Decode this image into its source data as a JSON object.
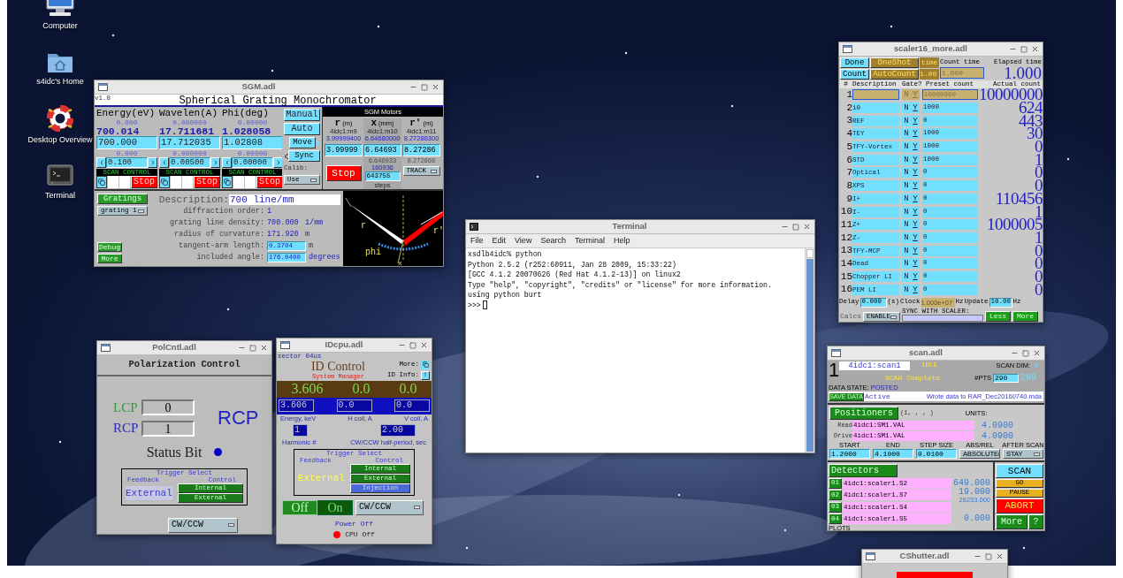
{
  "desktop_icons": [
    {
      "kind": "computer",
      "label": "Computer"
    },
    {
      "kind": "folder",
      "label": "s4idc's Home"
    },
    {
      "kind": "lifebuoy",
      "label": "Desktop Overview"
    },
    {
      "kind": "terminal",
      "label": "Terminal"
    }
  ],
  "sgm": {
    "title": "SGM.adl",
    "version": "v1.8",
    "heading": "Spherical Grating Monochromator",
    "axes": [
      {
        "header": "Energy(eV)",
        "low": "0.000",
        "readback": "700.014",
        "setpoint": "700.000",
        "high": "0.000",
        "step": "0.100",
        "scan_control": "SCAN CONTROL",
        "stop": "Stop"
      },
      {
        "header": "Wavelen(A)",
        "low": "0.000000",
        "readback": "17.711681",
        "setpoint": "17.712035",
        "high": "0.000000",
        "step": "0.00500",
        "scan_control": "SCAN CONTROL",
        "stop": "Stop"
      },
      {
        "header": "Phi(deg)",
        "low": "0.00000",
        "readback": "1.028058",
        "setpoint": "1.02808",
        "high": "0.00000",
        "step": "0.00000",
        "scan_control": "SCAN CONTROL",
        "stop": "Stop"
      }
    ],
    "modes": [
      "Manual",
      "Auto"
    ],
    "move": "Move",
    "sync": "Sync",
    "calib_label": "Calib:",
    "calib_menu": "Use",
    "motors_title": "SGM Motors",
    "motors": [
      {
        "symbol": "r",
        "unit": "(m)",
        "pv": "4idc1:m9",
        "readback": "3.99999400",
        "setpoint": "3.99999"
      },
      {
        "symbol": "x",
        "unit": "(mm)",
        "pv": "4idc1:m10",
        "readback": "6.64680000",
        "setpoint": "6.64693",
        "actual": "6.646933",
        "steps_readback": "160936",
        "steps_setpoint": "643755",
        "steps_label": "steps"
      },
      {
        "symbol": "r'",
        "unit": "(m)",
        "pv": "4idc1:m11",
        "readback": "8.27286300",
        "setpoint": "8.27286",
        "actual": "8.272868",
        "menu": "TRACK"
      }
    ],
    "motor_stop": "Stop",
    "gratings_button": "Gratings",
    "grating_menu": "grating 1",
    "description_label": "Description:",
    "description": "700 line/mm",
    "params": [
      {
        "kind": "text",
        "label": "diffraction order:",
        "value": "1"
      },
      {
        "kind": "text",
        "label": "grating line density:",
        "value": "700.000",
        "unit": "1/mm"
      },
      {
        "kind": "text",
        "label": "radius of curvature:",
        "value": "171.920",
        "unit": "m"
      },
      {
        "kind": "field",
        "label": "tangent-arm length:",
        "value": "0.3704",
        "unit": "m"
      },
      {
        "kind": "field",
        "label": "included angle:",
        "value": "176.0400",
        "unit": "degrees"
      }
    ],
    "debug_button": "Debug",
    "more_button": "More",
    "diagram_labels": [
      "r",
      "r'",
      "phi",
      "x"
    ]
  },
  "scaler": {
    "title": "scaler16_more.adl",
    "done": "Done",
    "count": "Count",
    "oneshot": "OneShot",
    "autocount": "AutoCount",
    "time_label": "time",
    "time_value": "1.00",
    "count_time_label": "Count time",
    "count_time": "1.000",
    "elapsed_label": "Elapsed time",
    "elapsed": "1.000",
    "columns": [
      "#",
      "Description",
      "Gate?",
      "Preset count",
      "Actual count"
    ],
    "rows": [
      {
        "num": "1",
        "gate_n": "N",
        "gate_y": "Y",
        "preset": "10000000",
        "actual": "10000000",
        "active": true
      },
      {
        "num": "2",
        "description": "i0",
        "gate_n": "N",
        "gate_y": "Y",
        "preset": "1000",
        "actual": "624",
        "active": false
      },
      {
        "num": "3",
        "description": "REF",
        "gate_n": "N",
        "gate_y": "Y",
        "preset": "0",
        "actual": "443",
        "active": false
      },
      {
        "num": "4",
        "description": "TEY",
        "gate_n": "N",
        "gate_y": "Y",
        "preset": "1000",
        "actual": "30",
        "active": false
      },
      {
        "num": "5",
        "description": "TFY-Vortex",
        "gate_n": "N",
        "gate_y": "Y",
        "preset": "1000",
        "actual": "0",
        "active": false
      },
      {
        "num": "6",
        "description": "STD",
        "gate_n": "N",
        "gate_y": "Y",
        "preset": "1000",
        "actual": "1",
        "active": false
      },
      {
        "num": "7",
        "description": "Optical",
        "gate_n": "N",
        "gate_y": "Y",
        "preset": "0",
        "actual": "0",
        "active": false
      },
      {
        "num": "8",
        "description": "XPS",
        "gate_n": "N",
        "gate_y": "Y",
        "preset": "0",
        "actual": "0",
        "active": false
      },
      {
        "num": "9",
        "description": "I+",
        "gate_n": "N",
        "gate_y": "Y",
        "preset": "0",
        "actual": "110456",
        "active": false
      },
      {
        "num": "10",
        "description": "I-",
        "gate_n": "N",
        "gate_y": "Y",
        "preset": "0",
        "actual": "1",
        "active": false
      },
      {
        "num": "11",
        "description": "Z+",
        "gate_n": "N",
        "gate_y": "Y",
        "preset": "0",
        "actual": "1000005",
        "active": false
      },
      {
        "num": "12",
        "description": "Z-",
        "gate_n": "N",
        "gate_y": "Y",
        "preset": "0",
        "actual": "1",
        "active": false
      },
      {
        "num": "13",
        "description": "TFY-MCP",
        "gate_n": "N",
        "gate_y": "Y",
        "preset": "0",
        "actual": "0",
        "active": false
      },
      {
        "num": "14",
        "description": "Dead",
        "gate_n": "N",
        "gate_y": "Y",
        "preset": "0",
        "actual": "0",
        "active": false
      },
      {
        "num": "15",
        "description": "Chopper LI",
        "gate_n": "N",
        "gate_y": "Y",
        "preset": "0",
        "actual": "0",
        "active": false
      },
      {
        "num": "16",
        "description": "PEM LI",
        "gate_n": "N",
        "gate_y": "Y",
        "preset": "0",
        "actual": "0",
        "active": false
      }
    ],
    "delay_label": "Delay",
    "delay": "0.000",
    "delay_unit": "(s)",
    "clock_label": "Clock",
    "clock": "1.000e+07",
    "clock_unit": "Hz",
    "update_label": "Update",
    "update": "10.00",
    "update_unit": "Hz",
    "calcs_label": "Calcs",
    "calcs_menu": "ENABLE",
    "sync_label": "SYNC WITH SCALER:",
    "less": "Less",
    "more": "More"
  },
  "terminal": {
    "title": "Terminal",
    "menu": [
      "File",
      "Edit",
      "View",
      "Search",
      "Terminal",
      "Help"
    ],
    "lines": [
      "xsdlb4idc% python",
      "Python 2.5.2 (r252:60911, Jan 28 2009, 15:33:22)",
      "[GCC 4.1.2 20070626 (Red Hat 4.1.2-13)] on linux2",
      "Type \"help\", \"copyright\", \"credits\" or \"license\" for more information.",
      "using python burt"
    ],
    "prompt": ">>>"
  },
  "scan": {
    "title": "scan.adl",
    "index": "1",
    "record": "4idc1:scan1",
    "status": "IDLE",
    "dim_label": "SCAN DIM:",
    "dim": "0",
    "message": "SCAN Complete",
    "pts_label": "#PTS",
    "pts_set": "290",
    "pts": "290",
    "data_state_label": "DATA STATE:",
    "data_state": "POSTED",
    "save_button": "SAVE DATA",
    "save_state": "Active",
    "save_message": "Wrote data to RAR_Dec20160740.mda",
    "positioners_button": "Positioners",
    "positioner_list": "(1, , , )",
    "units_label": "UNITS:",
    "read_label": "Read",
    "read_pv": "4idc1:SM1.VAL",
    "read_value": "4.0900",
    "drive_label": "Drive",
    "drive_pv": "4idc1:SM1.VAL",
    "drive_value": "4.0900",
    "range": [
      {
        "kind": "field",
        "label": "START",
        "value": "1.2000"
      },
      {
        "kind": "field",
        "label": "END",
        "value": "4.1000"
      },
      {
        "kind": "field",
        "label": "STEP SIZE",
        "value": "0.0100"
      },
      {
        "kind": "menu",
        "label": "ABS/REL",
        "value": "ABSOLUTE"
      },
      {
        "kind": "menu",
        "label": "AFTER SCAN",
        "value": "STAY"
      }
    ],
    "detectors_button": "Detectors",
    "detectors": [
      {
        "num": "01",
        "pv": "4idc1:scaler1.S2",
        "value": "649.000"
      },
      {
        "num": "02",
        "pv": "4idc1:scaler1.S7",
        "value": "19.000",
        "extra": "26233.000"
      },
      {
        "num": "03",
        "pv": "4idc1:scaler1.S4"
      },
      {
        "num": "04",
        "pv": "4idc1:scaler1.S5",
        "value": "0.000"
      }
    ],
    "plots_label": "PLOTS",
    "scan_button": "SCAN",
    "go_button": "GO",
    "pause_button": "PAUSE",
    "abort_button": "ABORT",
    "more_button": "More",
    "help_button": "?"
  },
  "polcntl": {
    "title": "PolCntl.adl",
    "heading": "Polarization Control",
    "lcp_label": "LCP",
    "lcp": "0",
    "rcp_label": "RCP",
    "rcp": "1",
    "mode": "RCP",
    "status_label": "Status Bit",
    "trigger_title": "Trigger Select",
    "feedback_label": "Feedback",
    "control_label": "Control",
    "feedback": "External",
    "controls": [
      {
        "label": "Internal",
        "selected": false
      },
      {
        "label": "External",
        "selected": false
      }
    ],
    "menu": "CW/CCW"
  },
  "idcpu": {
    "title": "IDcpu.adl",
    "sector": "sector 04us",
    "heading": "ID Control",
    "subheading": "System Manager",
    "more_label": "More:",
    "info_label": "ID Info:",
    "info_button": "!",
    "readbacks": [
      {
        "value": "3.606",
        "setpoint": "3.606",
        "label": "Energy, keV"
      },
      {
        "value": "0.0",
        "setpoint": "0.0",
        "label": "H coil, A"
      },
      {
        "value": "0.0",
        "setpoint": "0.0",
        "label": "V coil, A"
      }
    ],
    "harmonic": "1",
    "harmonic_label": "Harmonic #",
    "period": "2.00",
    "period_label": "CW/CCW half-period, sec",
    "trigger_title": "Trigger Select",
    "feedback_label": "Feedback",
    "control_label": "Control",
    "feedback": "External",
    "controls": [
      {
        "label": "Internal",
        "selected": false
      },
      {
        "label": "External",
        "selected": false
      },
      {
        "label": "Injection",
        "selected": true
      }
    ],
    "power": [
      {
        "label": "Off",
        "selected": true
      },
      {
        "label": "On",
        "selected": false
      }
    ],
    "menu": "CW/CCW",
    "power_status": "Power Off",
    "cpu_status": "CPU Off"
  },
  "cshutter": {
    "title": "CShutter.adl"
  }
}
